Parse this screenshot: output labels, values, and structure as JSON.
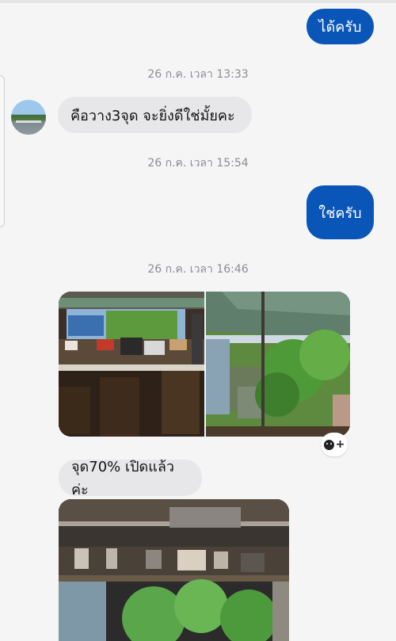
{
  "messages": {
    "m1_out": "ได้ครับ",
    "ts1": "26 ก.ค. เวลา 13:33",
    "m2_in": "คือวาง3จุด จะยิ่งดีใช่มั้ยคะ",
    "ts2": "26 ก.ค. เวลา 15:54",
    "m3_out": "ใช่ครับ",
    "ts3": "26 ก.ค. เวลา 16:46",
    "m4_in": "จุด70% เปิดแล้วค่ะ"
  },
  "colors": {
    "outgoing_bubble": "#0a56b8",
    "incoming_bubble": "#e7e7ea",
    "background": "#f5f5f6",
    "timestamp": "#8d8d92"
  },
  "icons": {
    "reaction": "add-reaction-icon"
  }
}
